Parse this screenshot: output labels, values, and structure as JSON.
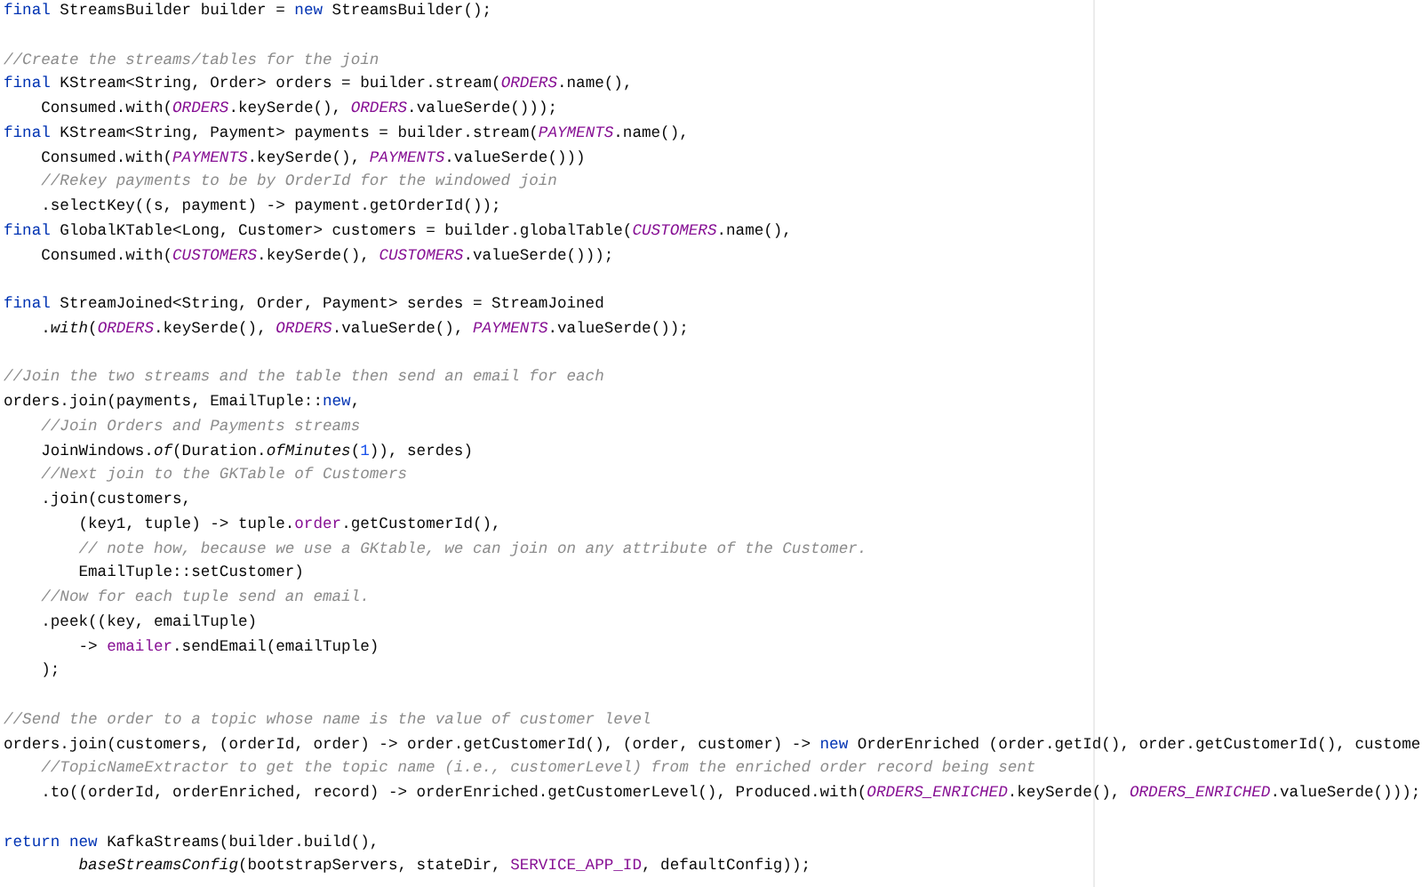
{
  "editor": {
    "lines": [
      {
        "kind": "code",
        "segments": [
          {
            "kind": "keyword",
            "text": "final"
          },
          {
            "kind": "plain",
            "text": " StreamsBuilder builder = "
          },
          {
            "kind": "keyword",
            "text": "new"
          },
          {
            "kind": "plain",
            "text": " StreamsBuilder();"
          }
        ]
      },
      {
        "kind": "blank"
      },
      {
        "kind": "code",
        "segments": [
          {
            "kind": "comment",
            "text": "//Create the streams/tables for the join"
          }
        ]
      },
      {
        "kind": "code",
        "segments": [
          {
            "kind": "keyword",
            "text": "final"
          },
          {
            "kind": "plain",
            "text": " KStream<String, Order> orders = builder.stream("
          },
          {
            "kind": "constant",
            "text": "ORDERS"
          },
          {
            "kind": "plain",
            "text": ".name(),"
          }
        ]
      },
      {
        "kind": "code",
        "segments": [
          {
            "kind": "plain",
            "text": "    Consumed.with("
          },
          {
            "kind": "constant",
            "text": "ORDERS"
          },
          {
            "kind": "plain",
            "text": ".keySerde(), "
          },
          {
            "kind": "constant",
            "text": "ORDERS"
          },
          {
            "kind": "plain",
            "text": ".valueSerde()));"
          }
        ]
      },
      {
        "kind": "code",
        "segments": [
          {
            "kind": "keyword",
            "text": "final"
          },
          {
            "kind": "plain",
            "text": " KStream<String, Payment> payments = builder.stream("
          },
          {
            "kind": "constant",
            "text": "PAYMENTS"
          },
          {
            "kind": "plain",
            "text": ".name(),"
          }
        ]
      },
      {
        "kind": "code",
        "segments": [
          {
            "kind": "plain",
            "text": "    Consumed.with("
          },
          {
            "kind": "constant",
            "text": "PAYMENTS"
          },
          {
            "kind": "plain",
            "text": ".keySerde(), "
          },
          {
            "kind": "constant",
            "text": "PAYMENTS"
          },
          {
            "kind": "plain",
            "text": ".valueSerde()))"
          }
        ]
      },
      {
        "kind": "code",
        "segments": [
          {
            "kind": "comment",
            "text": "    //Rekey payments to be by OrderId for the windowed join"
          }
        ]
      },
      {
        "kind": "code",
        "segments": [
          {
            "kind": "plain",
            "text": "    .selectKey((s, payment) -> payment.getOrderId());"
          }
        ]
      },
      {
        "kind": "code",
        "segments": [
          {
            "kind": "keyword",
            "text": "final"
          },
          {
            "kind": "plain",
            "text": " GlobalKTable<Long, Customer> customers = builder.globalTable("
          },
          {
            "kind": "constant",
            "text": "CUSTOMERS"
          },
          {
            "kind": "plain",
            "text": ".name(),"
          }
        ]
      },
      {
        "kind": "code",
        "segments": [
          {
            "kind": "plain",
            "text": "    Consumed.with("
          },
          {
            "kind": "constant",
            "text": "CUSTOMERS"
          },
          {
            "kind": "plain",
            "text": ".keySerde(), "
          },
          {
            "kind": "constant",
            "text": "CUSTOMERS"
          },
          {
            "kind": "plain",
            "text": ".valueSerde()));"
          }
        ]
      },
      {
        "kind": "blank"
      },
      {
        "kind": "code",
        "segments": [
          {
            "kind": "keyword",
            "text": "final"
          },
          {
            "kind": "plain",
            "text": " StreamJoined<String, Order, Payment> serdes = StreamJoined"
          }
        ]
      },
      {
        "kind": "code",
        "segments": [
          {
            "kind": "plain",
            "text": "    ."
          },
          {
            "kind": "static",
            "text": "with"
          },
          {
            "kind": "plain",
            "text": "("
          },
          {
            "kind": "constant",
            "text": "ORDERS"
          },
          {
            "kind": "plain",
            "text": ".keySerde(), "
          },
          {
            "kind": "constant",
            "text": "ORDERS"
          },
          {
            "kind": "plain",
            "text": ".valueSerde(), "
          },
          {
            "kind": "constant",
            "text": "PAYMENTS"
          },
          {
            "kind": "plain",
            "text": ".valueSerde());"
          }
        ]
      },
      {
        "kind": "blank"
      },
      {
        "kind": "code",
        "segments": [
          {
            "kind": "comment",
            "text": "//Join the two streams and the table then send an email for each"
          }
        ]
      },
      {
        "kind": "code",
        "segments": [
          {
            "kind": "plain",
            "text": "orders.join(payments, EmailTuple::"
          },
          {
            "kind": "keyword",
            "text": "new"
          },
          {
            "kind": "plain",
            "text": ","
          }
        ]
      },
      {
        "kind": "code",
        "segments": [
          {
            "kind": "comment",
            "text": "    //Join Orders and Payments streams"
          }
        ]
      },
      {
        "kind": "code",
        "segments": [
          {
            "kind": "plain",
            "text": "    JoinWindows."
          },
          {
            "kind": "static",
            "text": "of"
          },
          {
            "kind": "plain",
            "text": "(Duration."
          },
          {
            "kind": "static",
            "text": "ofMinutes"
          },
          {
            "kind": "plain",
            "text": "("
          },
          {
            "kind": "number",
            "text": "1"
          },
          {
            "kind": "plain",
            "text": ")), serdes)"
          }
        ]
      },
      {
        "kind": "code",
        "segments": [
          {
            "kind": "comment",
            "text": "    //Next join to the GKTable of Customers"
          }
        ]
      },
      {
        "kind": "code",
        "segments": [
          {
            "kind": "plain",
            "text": "    .join(customers,"
          }
        ]
      },
      {
        "kind": "code",
        "segments": [
          {
            "kind": "plain",
            "text": "        (key1, tuple) -> tuple."
          },
          {
            "kind": "field",
            "text": "order"
          },
          {
            "kind": "plain",
            "text": ".getCustomerId(),"
          }
        ]
      },
      {
        "kind": "code",
        "segments": [
          {
            "kind": "comment",
            "text": "        // note how, because we use a GKtable, we can join on any attribute of the Customer."
          }
        ]
      },
      {
        "kind": "code",
        "segments": [
          {
            "kind": "plain",
            "text": "        EmailTuple::setCustomer)"
          }
        ]
      },
      {
        "kind": "code",
        "segments": [
          {
            "kind": "comment",
            "text": "    //Now for each tuple send an email."
          }
        ]
      },
      {
        "kind": "code",
        "segments": [
          {
            "kind": "plain",
            "text": "    .peek((key, emailTuple)"
          }
        ]
      },
      {
        "kind": "code",
        "segments": [
          {
            "kind": "plain",
            "text": "        -> "
          },
          {
            "kind": "field",
            "text": "emailer"
          },
          {
            "kind": "plain",
            "text": ".sendEmail(emailTuple)"
          }
        ]
      },
      {
        "kind": "code",
        "segments": [
          {
            "kind": "plain",
            "text": "    );"
          }
        ]
      },
      {
        "kind": "blank"
      },
      {
        "kind": "code",
        "segments": [
          {
            "kind": "comment",
            "text": "//Send the order to a topic whose name is the value of customer level"
          }
        ]
      },
      {
        "kind": "code",
        "segments": [
          {
            "kind": "plain",
            "text": "orders.join(customers, (orderId, order) -> order.getCustomerId(), (order, customer) -> "
          },
          {
            "kind": "keyword",
            "text": "new"
          },
          {
            "kind": "plain",
            "text": " OrderEnriched (order.getId(), order.getCustomerId(), custome"
          }
        ]
      },
      {
        "kind": "code",
        "segments": [
          {
            "kind": "comment",
            "text": "    //TopicNameExtractor to get the topic name (i.e., customerLevel) from the enriched order record being sent"
          }
        ]
      },
      {
        "kind": "code",
        "segments": [
          {
            "kind": "plain",
            "text": "    .to((orderId, orderEnriched, record) -> orderEnriched.getCustomerLevel(), Produced.with("
          },
          {
            "kind": "constant",
            "text": "ORDERS_ENRICHED"
          },
          {
            "kind": "plain",
            "text": ".keySerde(), "
          },
          {
            "kind": "constant",
            "text": "ORDERS_ENRICHED"
          },
          {
            "kind": "plain",
            "text": ".valueSerde()));"
          }
        ]
      },
      {
        "kind": "blank"
      },
      {
        "kind": "code",
        "segments": [
          {
            "kind": "keyword",
            "text": "return new"
          },
          {
            "kind": "plain",
            "text": " KafkaStreams(builder.build(),"
          }
        ]
      },
      {
        "kind": "code",
        "segments": [
          {
            "kind": "static",
            "text": "        baseStreamsConfig"
          },
          {
            "kind": "plain",
            "text": "(bootstrapServers, stateDir, "
          },
          {
            "kind": "field",
            "text": "SERVICE_APP_ID"
          },
          {
            "kind": "plain",
            "text": ", defaultConfig));"
          }
        ]
      }
    ]
  }
}
